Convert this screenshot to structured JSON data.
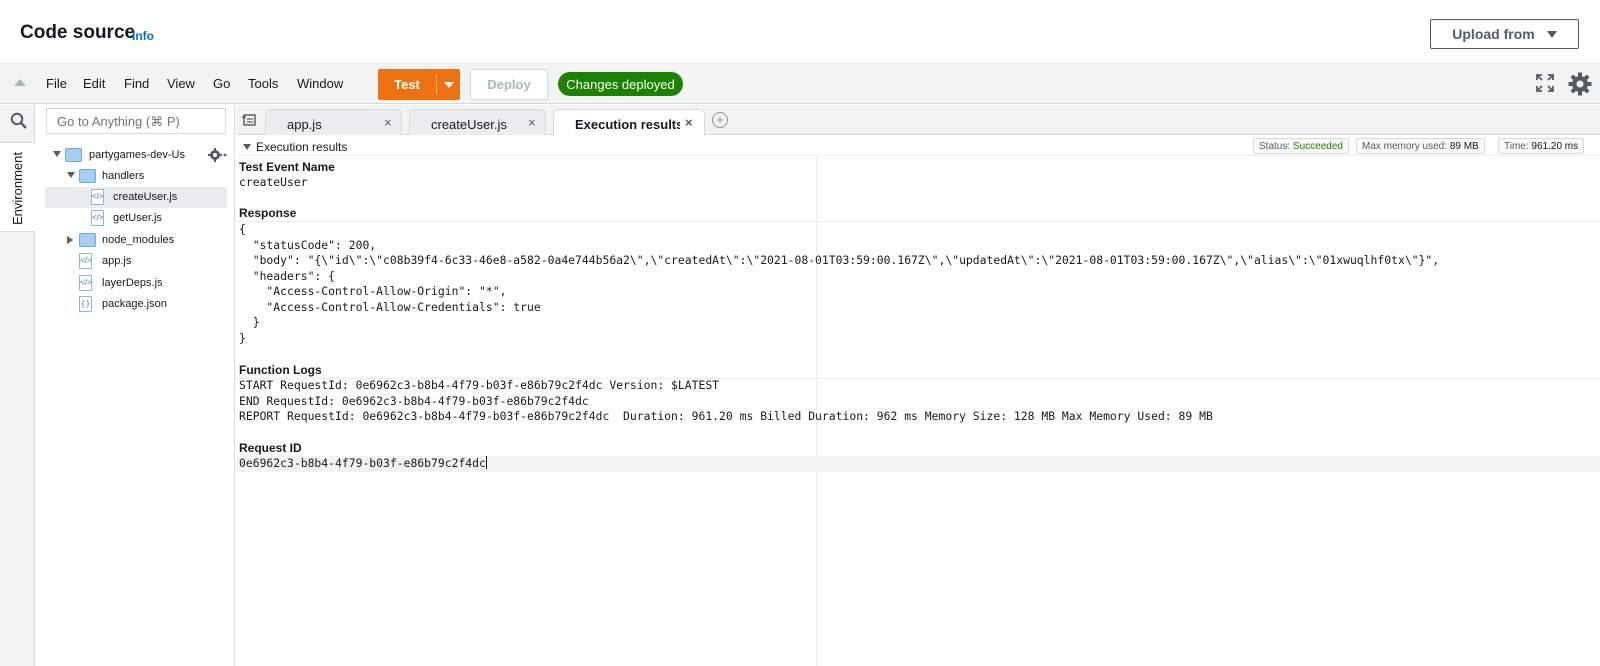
{
  "header": {
    "title": "Code source",
    "info_link": "Info",
    "upload_button": "Upload from"
  },
  "toolbar": {
    "menu": [
      "File",
      "Edit",
      "Find",
      "View",
      "Go",
      "Tools",
      "Window"
    ],
    "test_button": "Test",
    "deploy_button": "Deploy",
    "status_badge": "Changes deployed"
  },
  "sidebar": {
    "panel_label": "Environment",
    "search_placeholder": "Go to Anything (⌘ P)"
  },
  "file_tree": {
    "root": "partygames-dev-Use",
    "handlers_folder": "handlers",
    "handler_files": [
      "createUser.js",
      "getUser.js"
    ],
    "node_modules": "node_modules",
    "root_files": [
      "app.js",
      "layerDeps.js",
      "package.json"
    ],
    "selected": "createUser.js"
  },
  "tabs": [
    {
      "label": "app.js"
    },
    {
      "label": "createUser.js"
    },
    {
      "label": "Execution results"
    }
  ],
  "results": {
    "title": "Execution results",
    "status_label": "Status:",
    "status_value": "Succeeded",
    "memory_label": "Max memory used:",
    "memory_value": "89 MB",
    "time_label": "Time:",
    "time_value": "961.20 ms",
    "test_event_heading": "Test Event Name",
    "test_event_value": "createUser",
    "response_heading": "Response",
    "response_lines": [
      "{",
      "  \"statusCode\": 200,",
      "  \"body\": \"{\\\"id\\\":\\\"c08b39f4-6c33-46e8-a582-0a4e744b56a2\\\",\\\"createdAt\\\":\\\"2021-08-01T03:59:00.167Z\\\",\\\"updatedAt\\\":\\\"2021-08-01T03:59:00.167Z\\\",\\\"alias\\\":\\\"01xwuqlhf0tx\\\"}\",",
      "  \"headers\": {",
      "    \"Access-Control-Allow-Origin\": \"*\",",
      "    \"Access-Control-Allow-Credentials\": true",
      "  }",
      "}"
    ],
    "logs_heading": "Function Logs",
    "log_lines": [
      "START RequestId: 0e6962c3-b8b4-4f79-b03f-e86b79c2f4dc Version: $LATEST",
      "END RequestId: 0e6962c3-b8b4-4f79-b03f-e86b79c2f4dc",
      "REPORT RequestId: 0e6962c3-b8b4-4f79-b03f-e86b79c2f4dc  Duration: 961.20 ms Billed Duration: 962 ms Memory Size: 128 MB Max Memory Used: 89 MB"
    ],
    "request_id_heading": "Request ID",
    "request_id_value": "0e6962c3-b8b4-4f79-b03f-e86b79c2f4dc"
  }
}
